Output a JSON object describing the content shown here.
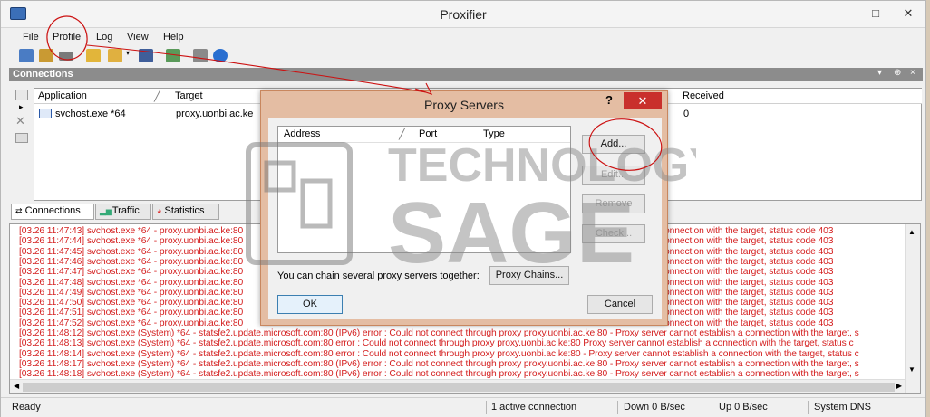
{
  "window": {
    "title": "Proxifier",
    "minimize": "–",
    "maximize": "□",
    "close": "✕"
  },
  "menu": [
    "File",
    "Profile",
    "Log",
    "View",
    "Help"
  ],
  "toolbar_icons": [
    "new-profile-icon",
    "open-profile-icon",
    "save-profile-icon",
    "add-rule-icon",
    "open-folder-icon",
    "dropdown-arrow-icon",
    "floppy-icon",
    "copy-icon",
    "printer-icon",
    "help-icon"
  ],
  "connections": {
    "panel_title": "Connections",
    "pin": "▾ ┛ ×",
    "columns": [
      "Application",
      "Target",
      "Received"
    ],
    "sort_mark": "╱",
    "rows": [
      {
        "app": "svchost.exe *64",
        "target": "proxy.uonbi.ac.ke",
        "received": "0"
      }
    ],
    "side_marker": "▸"
  },
  "tabs": [
    "Connections",
    "Traffic",
    "Statistics"
  ],
  "log_lines": [
    "[03.26 11:47:43] svchost.exe *64 - proxy.uonbi.ac.ke:80",
    "[03.26 11:47:44] svchost.exe *64 - proxy.uonbi.ac.ke:80",
    "[03.26 11:47:45] svchost.exe *64 - proxy.uonbi.ac.ke:80",
    "[03.26 11:47:46] svchost.exe *64 - proxy.uonbi.ac.ke:80",
    "[03.26 11:47:47] svchost.exe *64 - proxy.uonbi.ac.ke:80",
    "[03.26 11:47:48] svchost.exe *64 - proxy.uonbi.ac.ke:80",
    "[03.26 11:47:49] svchost.exe *64 - proxy.uonbi.ac.ke:80",
    "[03.26 11:47:50] svchost.exe *64 - proxy.uonbi.ac.ke:80",
    "[03.26 11:47:51] svchost.exe *64 - proxy.uonbi.ac.ke:80",
    "[03.26 11:47:52] svchost.exe *64 - proxy.uonbi.ac.ke:80",
    "[03.26 11:48:12] svchost.exe (System) *64 - statsfe2.update.microsoft.com:80 (IPv6) error : Could not connect through proxy proxy.uonbi.ac.ke:80 - Proxy server cannot establish a connection with the target, s",
    "[03.26 11:48:13] svchost.exe (System) *64 - statsfe2.update.microsoft.com:80 error : Could not connect through proxy proxy.uonbi.ac.ke:80   Proxy server cannot establish a connection with the target, status c",
    "[03.26 11:48:14] svchost.exe (System) *64 - statsfe2.update.microsoft.com:80 error : Could not connect through proxy proxy.uonbi.ac.ke:80 - Proxy server cannot establish a connection with the target, status c",
    "[03.26 11:48:17] svchost.exe (System) *64 - statsfe2.update.microsoft.com:80 (IPv6) error : Could not connect through proxy proxy.uonbi.ac.ke:80 - Proxy server cannot establish a connection with the target, s",
    "[03.26 11:48:18] svchost.exe (System) *64 - statsfe2.update.microsoft.com:80 (IPv6) error : Could not connect through proxy proxy.uonbi.ac.ke:80 - Proxy server cannot establish a connection with the target, s"
  ],
  "log_right_lines": [
    "onnection with the target, status code 403",
    "onnection with the target, status code 403",
    "onnection with the target, status code 403",
    "onnection with the target, status code 403",
    "onnection with the target, status code 403",
    "onnection with the target, status code 403",
    "onnection with the target, status code 403",
    "onnection with the target, status code 403",
    "onnection with the target, status code 403",
    "onnection with the target, status code 403"
  ],
  "status": {
    "left": "Ready",
    "connections": "1 active connection",
    "down": "Down 0 B/sec",
    "up": "Up 0 B/sec",
    "dns": "System DNS"
  },
  "dialog": {
    "title": "Proxy Servers",
    "help": "?",
    "close": "✕",
    "columns": [
      "Address",
      "Port",
      "Type"
    ],
    "sort_mark": "╱",
    "buttons": {
      "add": "Add...",
      "edit": "Edit...",
      "remove": "Remove",
      "check": "Check..."
    },
    "chain_text": "You can chain several proxy servers together:",
    "chains_button": "Proxy Chains...",
    "ok": "OK",
    "cancel": "Cancel"
  },
  "colors": {
    "log_error": "#d42020",
    "dialog_frame": "#e4bda3",
    "close_red": "#c9302c",
    "annotation": "#cc1111"
  }
}
